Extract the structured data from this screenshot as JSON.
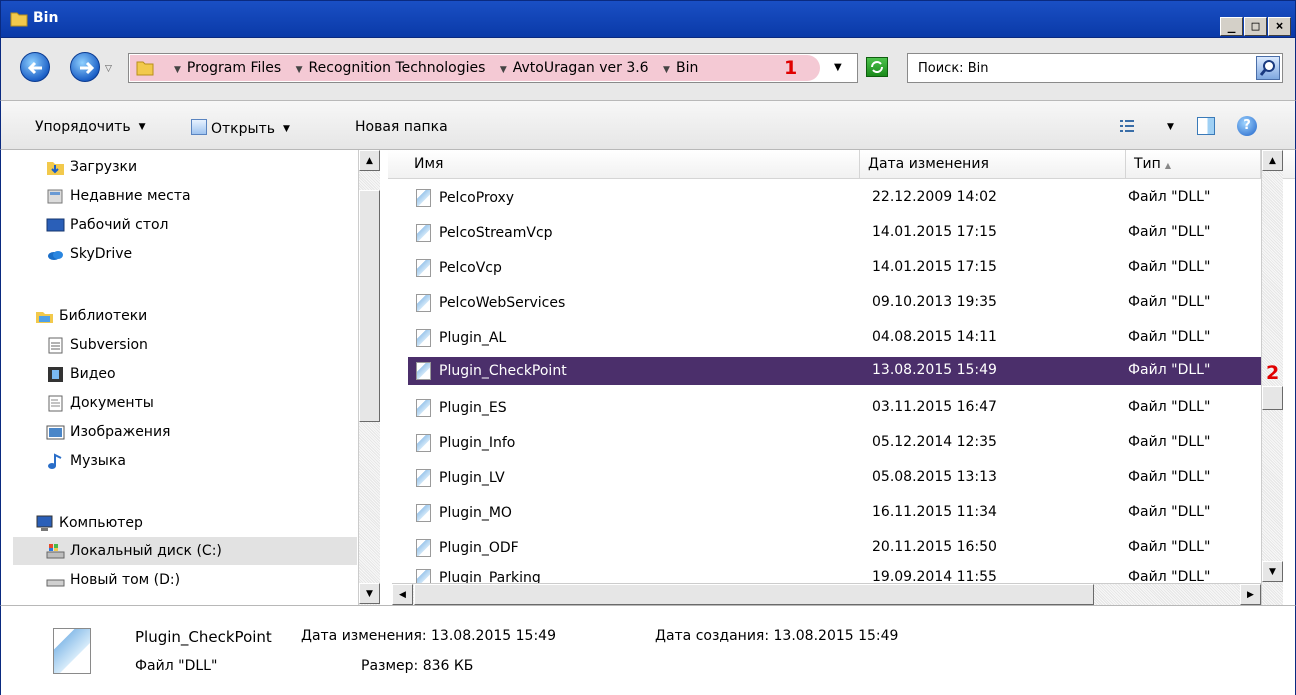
{
  "window": {
    "title": "Bin"
  },
  "address": {
    "crumbs": [
      "Program Files",
      "Recognition Technologies",
      "AvtoUragan ver 3.6",
      "Bin"
    ],
    "marker": "1"
  },
  "search": {
    "value": "Поиск: Bin"
  },
  "toolbar": {
    "organize_label": "Упорядочить",
    "open_label": "Открыть",
    "new_folder_label": "Новая папка"
  },
  "nav": {
    "items": [
      {
        "label": "Загрузки",
        "icon": "downloads-folder-icon"
      },
      {
        "label": "Недавние места",
        "icon": "recent-places-icon"
      },
      {
        "label": "Рабочий стол",
        "icon": "desktop-icon"
      },
      {
        "label": "SkyDrive",
        "icon": "skydrive-icon"
      },
      {
        "label": "Библиотеки",
        "icon": "libraries-icon"
      },
      {
        "label": "Subversion",
        "icon": "library-doc-icon"
      },
      {
        "label": "Видео",
        "icon": "video-icon"
      },
      {
        "label": "Документы",
        "icon": "documents-icon"
      },
      {
        "label": "Изображения",
        "icon": "pictures-icon"
      },
      {
        "label": "Музыка",
        "icon": "music-icon"
      },
      {
        "label": "Компьютер",
        "icon": "computer-icon"
      },
      {
        "label": "Локальный диск (C:)",
        "icon": "local-disk-icon"
      },
      {
        "label": "Новый том (D:)",
        "icon": "drive-icon"
      }
    ]
  },
  "files": {
    "columns": [
      "Имя",
      "Дата изменения",
      "Тип"
    ],
    "rows": [
      {
        "name": "PelcoProxy",
        "date": "22.12.2009 14:02",
        "type": "Файл \"DLL\""
      },
      {
        "name": "PelcoStreamVcp",
        "date": "14.01.2015 17:15",
        "type": "Файл \"DLL\""
      },
      {
        "name": "PelcoVcp",
        "date": "14.01.2015 17:15",
        "type": "Файл \"DLL\""
      },
      {
        "name": "PelcoWebServices",
        "date": "09.10.2013 19:35",
        "type": "Файл \"DLL\""
      },
      {
        "name": "Plugin_AL",
        "date": "04.08.2015 14:11",
        "type": "Файл \"DLL\""
      },
      {
        "name": "Plugin_CheckPoint",
        "date": "13.08.2015 15:49",
        "type": "Файл \"DLL\"",
        "selected": true
      },
      {
        "name": "Plugin_ES",
        "date": "03.11.2015 16:47",
        "type": "Файл \"DLL\""
      },
      {
        "name": "Plugin_Info",
        "date": "05.12.2014 12:35",
        "type": "Файл \"DLL\""
      },
      {
        "name": "Plugin_LV",
        "date": "05.08.2015 13:13",
        "type": "Файл \"DLL\""
      },
      {
        "name": "Plugin_MO",
        "date": "16.11.2015 11:34",
        "type": "Файл \"DLL\""
      },
      {
        "name": "Plugin_ODF",
        "date": "20.11.2015 16:50",
        "type": "Файл \"DLL\""
      },
      {
        "name": "Plugin_Parking",
        "date": "19.09.2014 11:55",
        "type": "Файл \"DLL\""
      }
    ],
    "marker": "2"
  },
  "details": {
    "name": "Plugin_CheckPoint",
    "modified": "Дата изменения: 13.08.2015 15:49",
    "created": "Дата создания: 13.08.2015 15:49",
    "type": "Файл \"DLL\"",
    "size": "Размер: 836 КБ"
  },
  "colors": {
    "selection": "#4b2f6b",
    "title_bar": "#0a3aa8",
    "marker": "#e00000"
  }
}
